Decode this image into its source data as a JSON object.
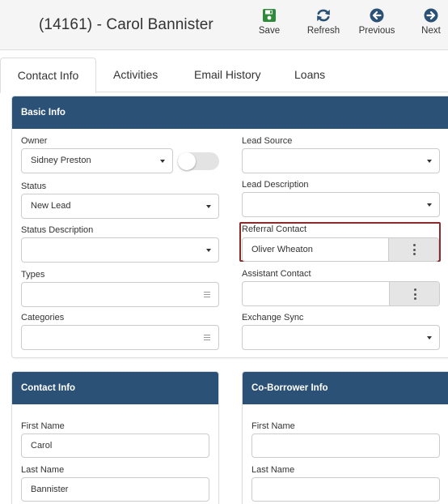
{
  "header": {
    "title": "(14161) - Carol Bannister",
    "save_label": "Save",
    "refresh_label": "Refresh",
    "previous_label": "Previous",
    "next_label": "Next"
  },
  "tabs": [
    {
      "label": "Contact Info",
      "active": true
    },
    {
      "label": "Activities"
    },
    {
      "label": "Email History"
    },
    {
      "label": "Loans"
    }
  ],
  "colors": {
    "panel_header": "#2b5176",
    "save_icon": "#2e8b3a",
    "nav_icon": "#2b5176",
    "highlight_border": "#8b2a2a"
  },
  "basic_info": {
    "heading": "Basic Info",
    "owner": {
      "label": "Owner",
      "value": "Sidney Preston"
    },
    "owner_toggle": {
      "on": false
    },
    "status": {
      "label": "Status",
      "value": "New Lead"
    },
    "status_description": {
      "label": "Status Description",
      "value": ""
    },
    "types": {
      "label": "Types",
      "value": ""
    },
    "categories": {
      "label": "Categories",
      "value": ""
    },
    "lead_source": {
      "label": "Lead Source",
      "value": ""
    },
    "lead_description": {
      "label": "Lead Description",
      "value": ""
    },
    "referral_contact": {
      "label": "Referral Contact",
      "value": "Oliver Wheaton"
    },
    "assistant_contact": {
      "label": "Assistant Contact",
      "value": ""
    },
    "exchange_sync": {
      "label": "Exchange Sync",
      "value": ""
    }
  },
  "contact_info": {
    "heading": "Contact Info",
    "first_name": {
      "label": "First Name",
      "value": "Carol"
    },
    "last_name": {
      "label": "Last Name",
      "value": "Bannister"
    }
  },
  "co_borrower_info": {
    "heading": "Co-Borrower Info",
    "first_name": {
      "label": "First Name",
      "value": ""
    },
    "last_name": {
      "label": "Last Name",
      "value": ""
    }
  },
  "icons": [
    "save-icon",
    "refresh-icon",
    "previous-icon",
    "next-icon",
    "dropdown-caret-icon",
    "list-icon",
    "kebab-menu-icon"
  ]
}
